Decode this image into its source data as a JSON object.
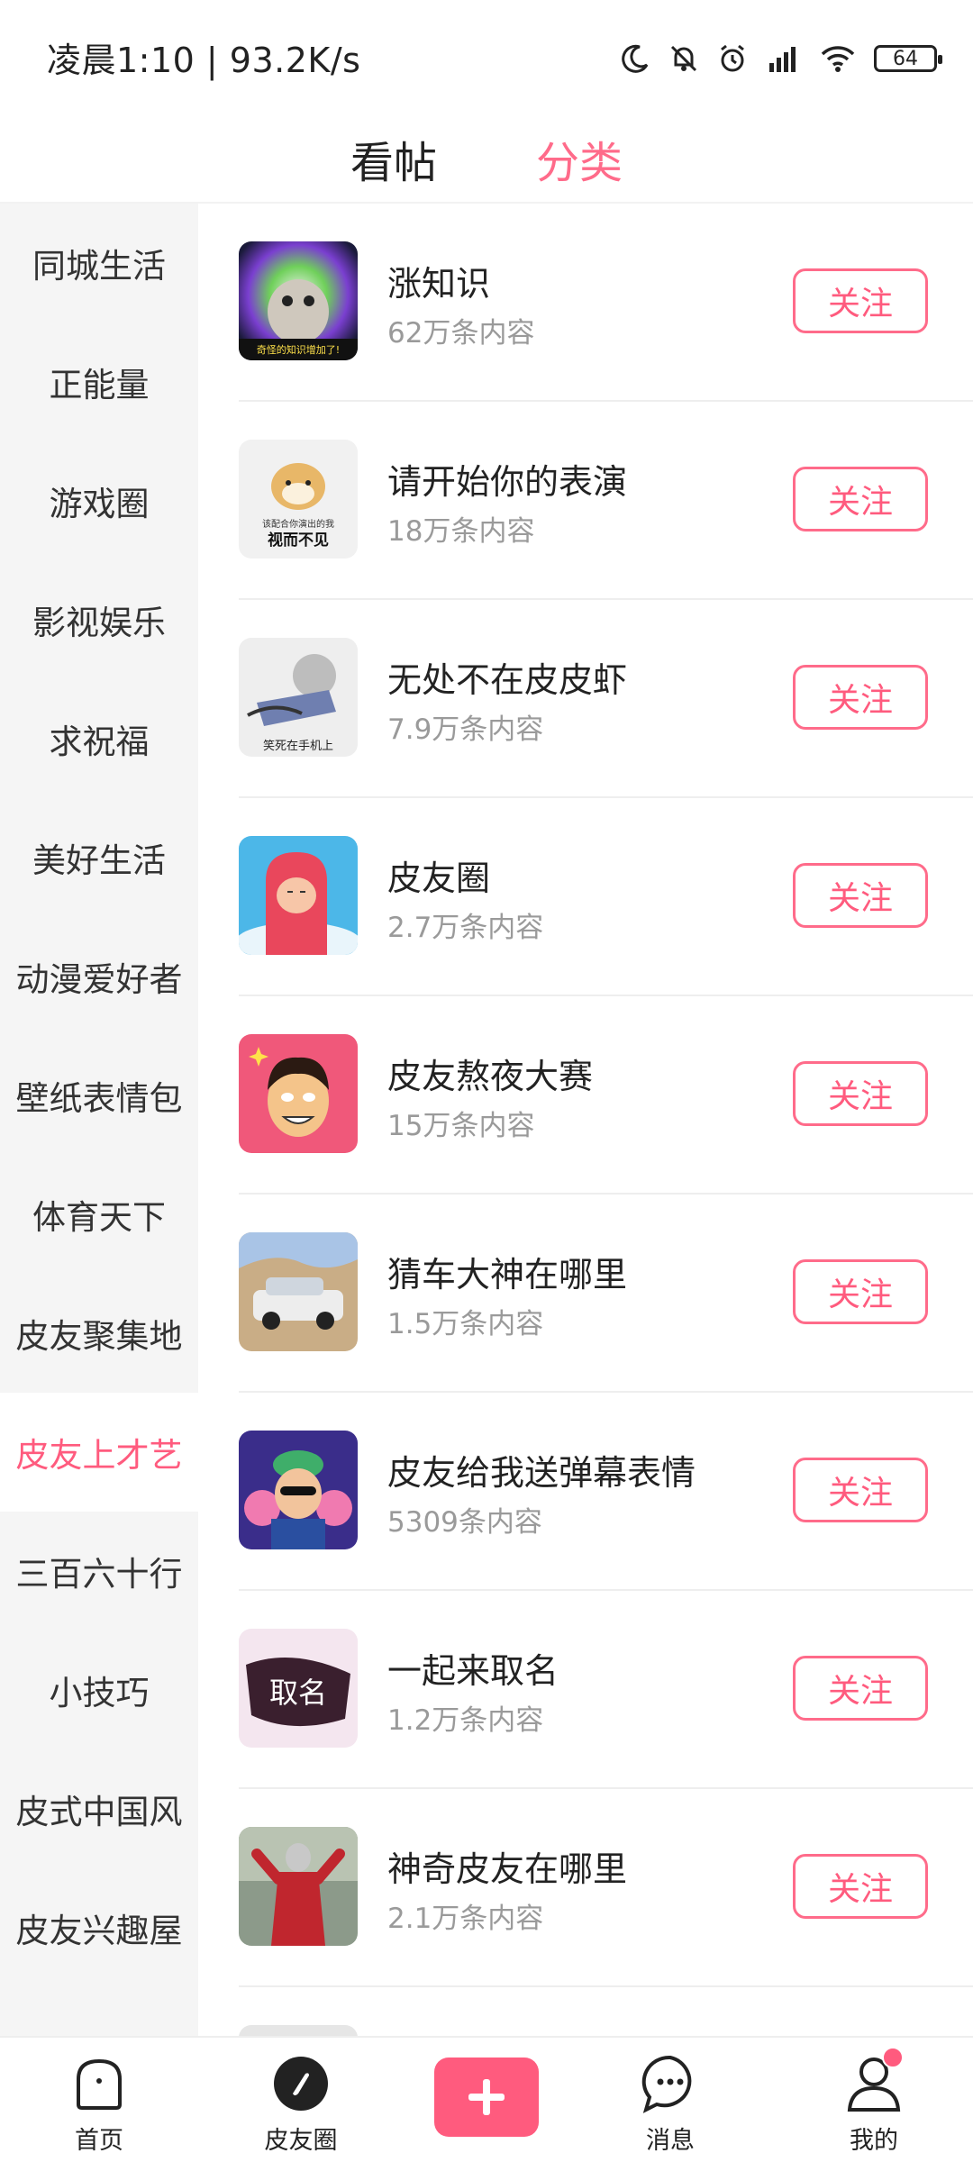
{
  "status": {
    "time_speed": "凌晨1:10 | 93.2K/s",
    "battery": "64"
  },
  "header": {
    "tabs": [
      {
        "label": "看帖",
        "active": false
      },
      {
        "label": "分类",
        "active": true
      }
    ]
  },
  "sidebar": {
    "items": [
      {
        "label": "同城生活",
        "active": false
      },
      {
        "label": "正能量",
        "active": false
      },
      {
        "label": "游戏圈",
        "active": false
      },
      {
        "label": "影视娱乐",
        "active": false
      },
      {
        "label": "求祝福",
        "active": false
      },
      {
        "label": "美好生活",
        "active": false
      },
      {
        "label": "动漫爱好者",
        "active": false
      },
      {
        "label": "壁纸表情包",
        "active": false
      },
      {
        "label": "体育天下",
        "active": false
      },
      {
        "label": "皮友聚集地",
        "active": false
      },
      {
        "label": "皮友上才艺",
        "active": true
      },
      {
        "label": "三百六十行",
        "active": false
      },
      {
        "label": "小技巧",
        "active": false
      },
      {
        "label": "皮式中国风",
        "active": false
      },
      {
        "label": "皮友兴趣屋",
        "active": false
      }
    ]
  },
  "topics": [
    {
      "title": "涨知识",
      "count": "62万条内容",
      "button": "关注",
      "thumb_caption": "奇怪的知识增加了!"
    },
    {
      "title": "请开始你的表演",
      "count": "18万条内容",
      "button": "关注",
      "thumb_caption": "该配合你演出的我",
      "thumb_caption2": "视而不见"
    },
    {
      "title": "无处不在皮皮虾",
      "count": "7.9万条内容",
      "button": "关注",
      "thumb_caption": "笑死在手机上"
    },
    {
      "title": "皮友圈",
      "count": "2.7万条内容",
      "button": "关注"
    },
    {
      "title": "皮友熬夜大赛",
      "count": "15万条内容",
      "button": "关注"
    },
    {
      "title": "猜车大神在哪里",
      "count": "1.5万条内容",
      "button": "关注"
    },
    {
      "title": "皮友给我送弹幕表情",
      "count": "5309条内容",
      "button": "关注"
    },
    {
      "title": "一起来取名",
      "count": "1.2万条内容",
      "button": "关注",
      "thumb_caption": "取名"
    },
    {
      "title": "神奇皮友在哪里",
      "count": "2.1万条内容",
      "button": "关注"
    }
  ],
  "bottom_nav": {
    "home": "首页",
    "circle": "皮友圈",
    "messages": "消息",
    "mine": "我的"
  },
  "colors": {
    "accent": "#ff5b7e",
    "sidebar_bg": "#f5f5f5"
  }
}
